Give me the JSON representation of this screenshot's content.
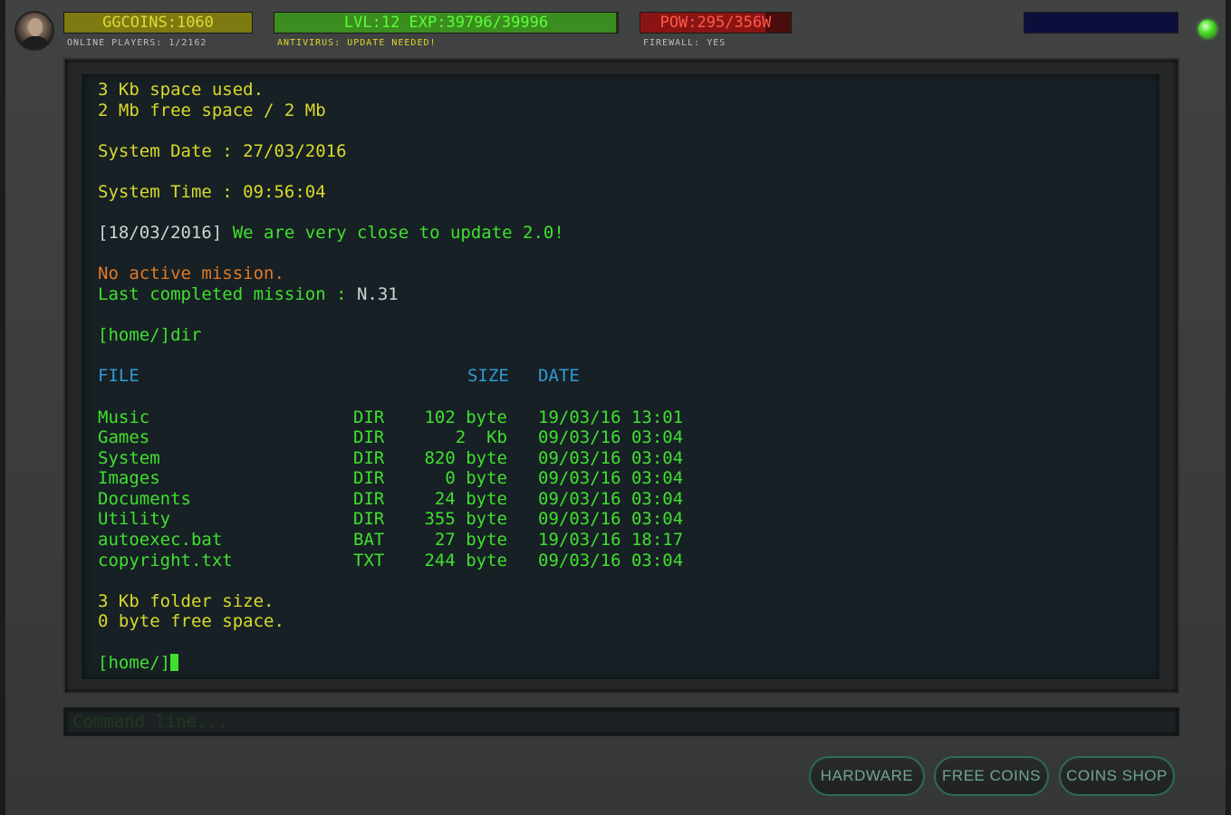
{
  "header": {
    "coins_label": "GGCOINS:1060",
    "online_players": "ONLINE PLAYERS: 1/2162",
    "level_exp_label": "LVL:12   EXP:39796/39996",
    "exp_fraction": 0.995,
    "antivirus_status": "ANTIVIRUS: UPDATE NEEDED!",
    "power_label": "POW:295/356W",
    "power_fraction": 0.83,
    "firewall_status": "FIREWALL: YES"
  },
  "terminal": {
    "space_used": "3 Kb space used.",
    "free_space": "2 Mb free space / 2 Mb",
    "system_date": "System Date : 27/03/2016",
    "system_time": "System Time : 09:56:04",
    "news_date": "[18/03/2016]",
    "news_text": "We are very close to update 2.0!",
    "no_mission": "No active mission.",
    "last_mission_label": "Last completed mission : ",
    "last_mission_value": "N.31",
    "dir_command": "[home/]dir",
    "col_file": "FILE",
    "col_size": "SIZE",
    "col_date": "DATE",
    "files": [
      {
        "name": "Music",
        "type": "DIR",
        "size": "102 byte",
        "date": "19/03/16 13:01"
      },
      {
        "name": "Games",
        "type": "DIR",
        "size": "2  Kb",
        "date": "09/03/16 03:04"
      },
      {
        "name": "System",
        "type": "DIR",
        "size": "820 byte",
        "date": "09/03/16 03:04"
      },
      {
        "name": "Images",
        "type": "DIR",
        "size": "0 byte",
        "date": "09/03/16 03:04"
      },
      {
        "name": "Documents",
        "type": "DIR",
        "size": "24 byte",
        "date": "09/03/16 03:04"
      },
      {
        "name": "Utility",
        "type": "DIR",
        "size": "355 byte",
        "date": "09/03/16 03:04"
      },
      {
        "name": "autoexec.bat",
        "type": "BAT",
        "size": "27 byte",
        "date": "19/03/16 18:17"
      },
      {
        "name": "copyright.txt",
        "type": "TXT",
        "size": "244 byte",
        "date": "09/03/16 03:04"
      }
    ],
    "folder_size": "3 Kb folder size.",
    "byte_free": "0 byte free space.",
    "prompt": "[home/]"
  },
  "command_line": {
    "placeholder": "Command line..."
  },
  "buttons": {
    "hardware": "HARDWARE",
    "free_coins": "FREE COINS",
    "coins_shop": "COINS SHOP"
  },
  "colors": {
    "terminal_bg": "#172024",
    "text_yellow": "#d9d92c",
    "text_green": "#3fe02f",
    "text_orange": "#e07a25",
    "text_blue": "#2e9ad8",
    "button_border": "#2e6a58"
  }
}
